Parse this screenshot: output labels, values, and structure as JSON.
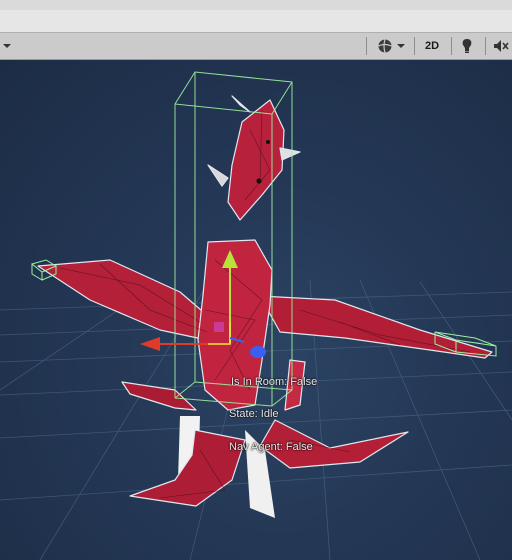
{
  "toolbar": {
    "left_dropdown_icon": "chevron-down-icon",
    "buttons": [
      {
        "name": "orientation-gizmo",
        "icon": "globe-icon"
      },
      {
        "name": "dropdown",
        "icon": "chevron-down-icon"
      },
      {
        "name": "2d-toggle",
        "label": "2D"
      },
      {
        "name": "lighting-toggle",
        "icon": "bulb-icon"
      },
      {
        "name": "audio-toggle",
        "icon": "mute-speaker-icon"
      }
    ],
    "mode_2d_label": "2D"
  },
  "scene": {
    "labels": {
      "in_room": "Is In Room: False",
      "state": "State: Idle",
      "nav_agent": "Nav Agent: False"
    },
    "colors": {
      "background": "#22334c",
      "grid": "#4a6584",
      "model_red": "#b8203a",
      "bounds_green": "#9ef09e",
      "gizmo_x": "#e23a2a",
      "gizmo_y": "#a7d93a",
      "gizmo_z": "#3a5ff2"
    }
  }
}
